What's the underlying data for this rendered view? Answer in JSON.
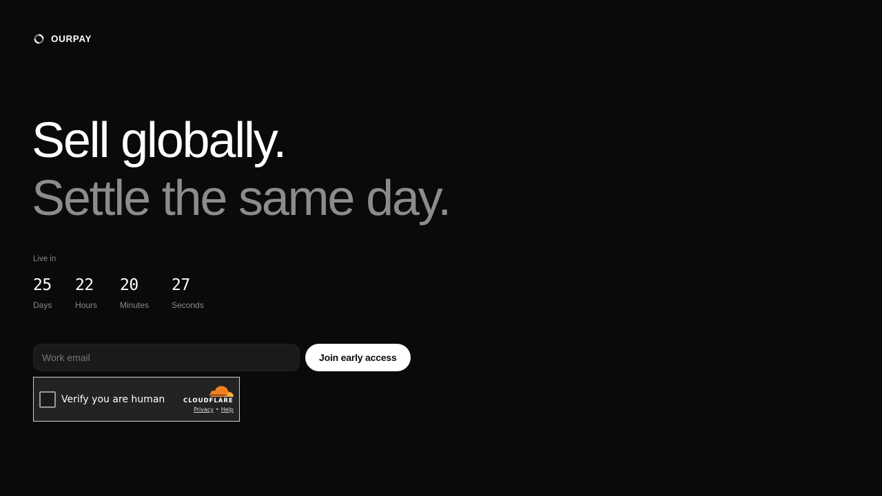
{
  "brand": {
    "name": "OURPAY",
    "icon": "circular-arrows-icon"
  },
  "hero": {
    "line1": "Sell globally.",
    "line2": "Settle the same day."
  },
  "countdown": {
    "label": "Live in",
    "units": [
      {
        "value": "25",
        "label": "Days"
      },
      {
        "value": "22",
        "label": "Hours"
      },
      {
        "value": "20",
        "label": "Minutes"
      },
      {
        "value": "27",
        "label": "Seconds"
      }
    ]
  },
  "signup": {
    "email_placeholder": "Work email",
    "email_value": "",
    "button_label": "Join early access"
  },
  "captcha": {
    "label": "Verify you are human",
    "provider": "CLOUDFLARE",
    "privacy_link": "Privacy",
    "separator": "•",
    "help_link": "Help",
    "accent_color": "#f38020"
  },
  "colors": {
    "background": "#0a0a0a",
    "text_primary": "#ffffff",
    "text_muted": "#8c8c8c",
    "button_bg": "#ffffff"
  }
}
